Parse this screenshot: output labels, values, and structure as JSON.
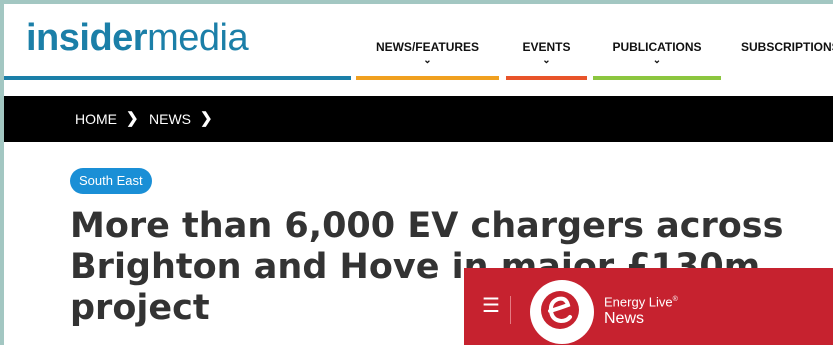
{
  "brand": {
    "logo_bold": "insider",
    "logo_light": "media",
    "accent": "#1b7fa8"
  },
  "nav": {
    "items": [
      {
        "label": "NEWS/FEATURES",
        "has_dropdown": true,
        "color": "#f0a020"
      },
      {
        "label": "EVENTS",
        "has_dropdown": true,
        "color": "#e8542a"
      },
      {
        "label": "PUBLICATIONS",
        "has_dropdown": true,
        "color": "#8cc63f"
      },
      {
        "label": "SUBSCRIPTIONS",
        "has_dropdown": false,
        "color": "#1b7fa8"
      }
    ],
    "dropdown_icon": "chevron-down-icon"
  },
  "breadcrumb": {
    "items": [
      "HOME",
      "NEWS"
    ],
    "separator_icon": "chevron-right-icon"
  },
  "article": {
    "tag": "South East",
    "tag_color": "#1a8fd6",
    "headline_line1": "More than 6,000 EV chargers across",
    "headline_line2": "Brighton and Hove in major £130m",
    "headline_line3": "project"
  },
  "ad": {
    "title": "Energy Live",
    "title_mark": "®",
    "subtitle": "News",
    "background": "#c6222f",
    "menu_icon": "hamburger-menu-icon",
    "logo_icon": "energy-live-logo-icon"
  }
}
